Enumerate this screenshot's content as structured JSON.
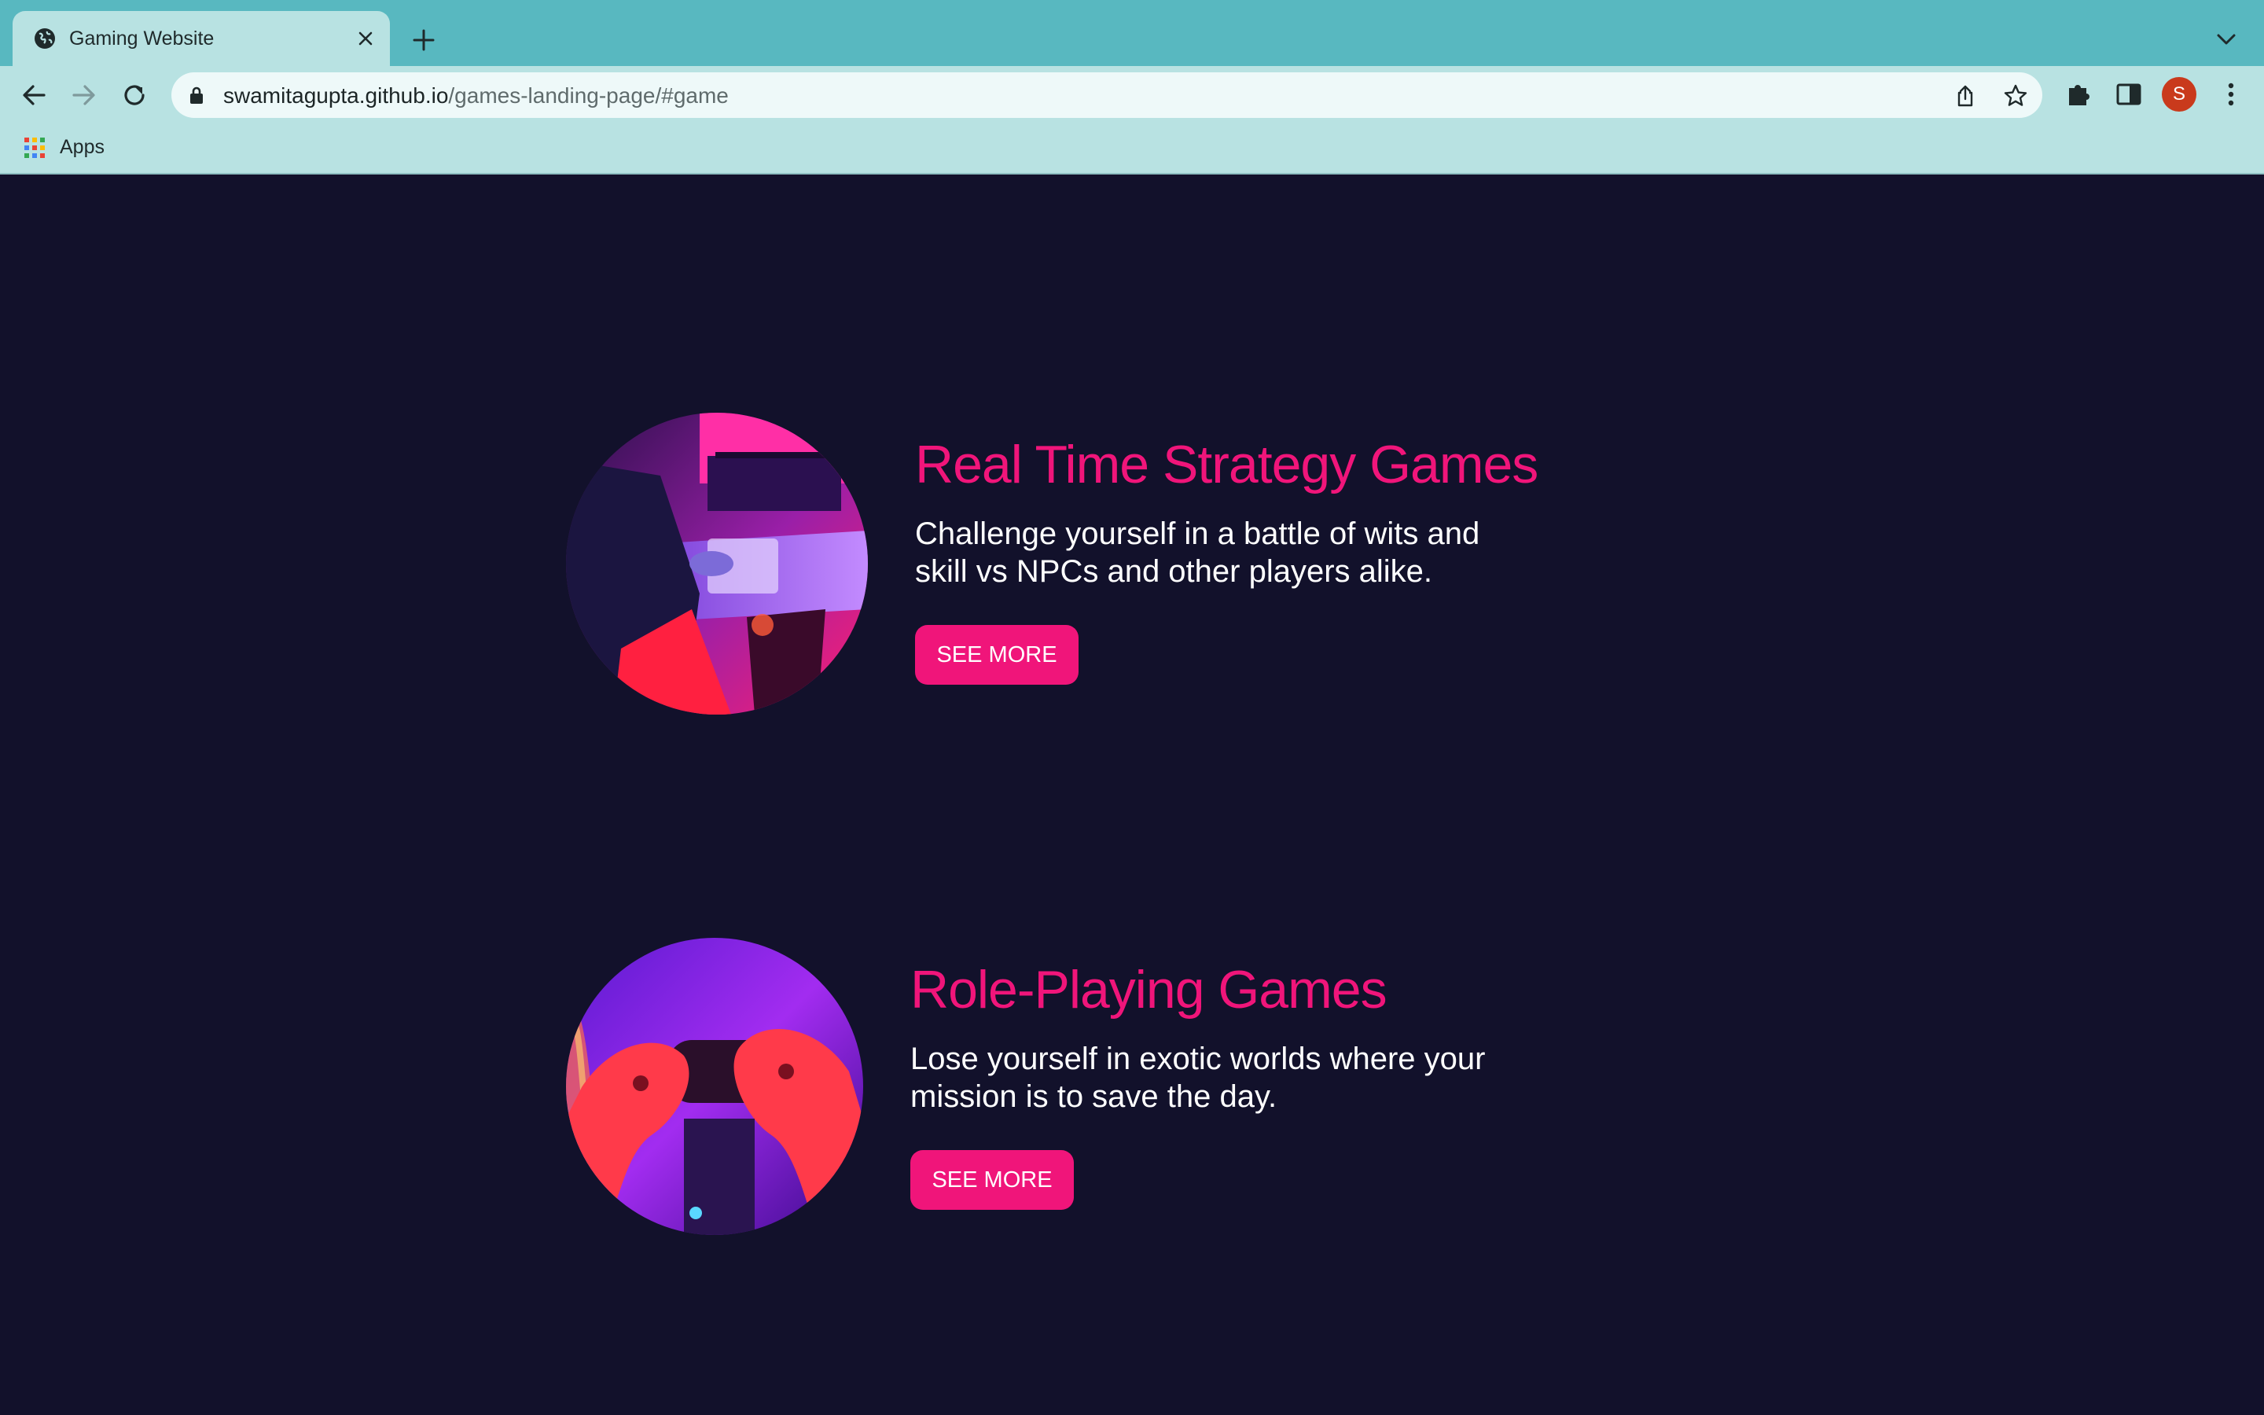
{
  "browser": {
    "tab": {
      "title": "Gaming Website",
      "favicon": "globe-icon"
    },
    "url": {
      "host": "swamitagupta.github.io",
      "path": "/games-landing-page/#game"
    },
    "profile_initial": "S",
    "bookmarks": {
      "apps_label": "Apps"
    },
    "colors": {
      "tabstrip": "#58b8c0",
      "toolbar": "#b8e2e2",
      "avatar": "#c93a1c"
    }
  },
  "page": {
    "background": "#12112b",
    "accent": "#f0157a",
    "games": [
      {
        "title": "Real Time Strategy Games",
        "description": "Challenge yourself in a battle of wits and skill vs NPCs and other players alike.",
        "button_label": "SEE MORE",
        "image": "gamer-at-desk-photo"
      },
      {
        "title": "Role-Playing Games",
        "description": "Lose yourself in exotic worlds where your mission is to save the day.",
        "button_label": "SEE MORE",
        "image": "hands-holding-controller-photo"
      }
    ]
  }
}
